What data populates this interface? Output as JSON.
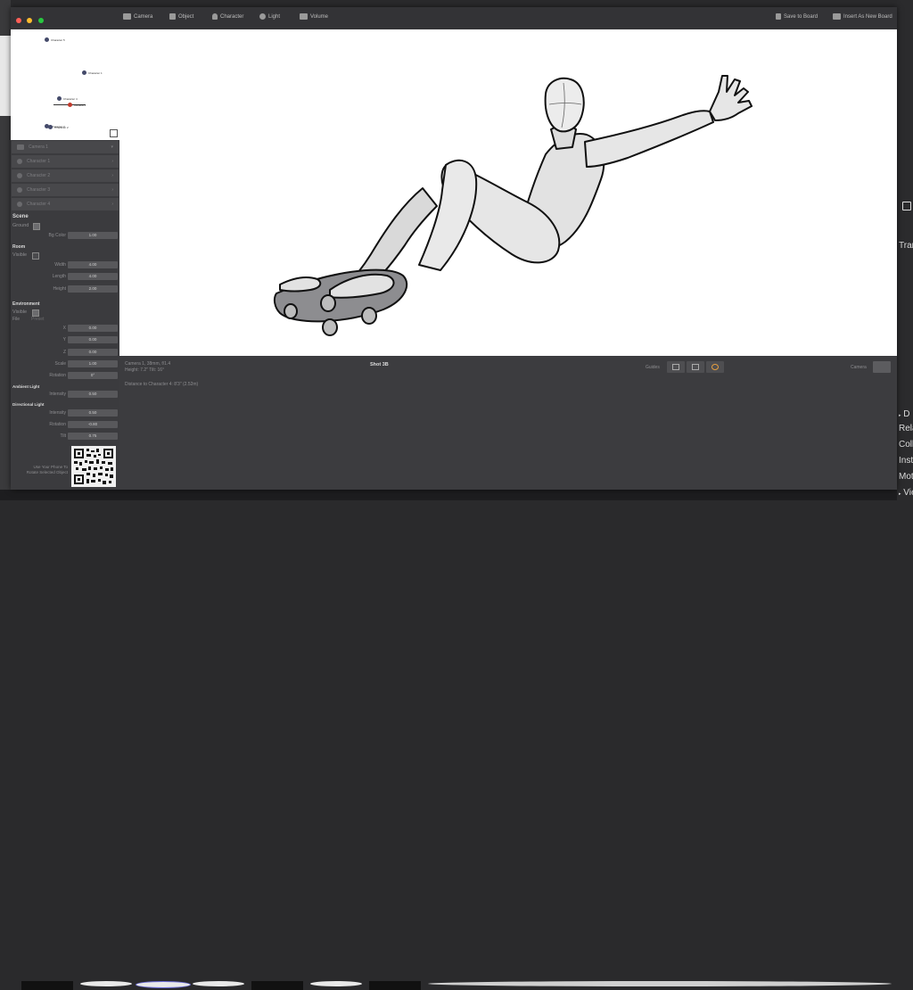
{
  "desktop": {
    "right_labels": [
      "Tran",
      "D",
      "Rela",
      "Coll",
      "Inst",
      "Mot",
      "View"
    ]
  },
  "toolbar": {
    "buttons": [
      {
        "label": "Camera",
        "icon": "camera-icon"
      },
      {
        "label": "Object",
        "icon": "cube-icon"
      },
      {
        "label": "Character",
        "icon": "person-icon"
      },
      {
        "label": "Light",
        "icon": "light-icon"
      },
      {
        "label": "Volume",
        "icon": "volume-icon"
      }
    ],
    "save_label": "Save to Board",
    "insert_label": "Insert As New Board"
  },
  "overhead": {
    "markers": [
      "Character 5",
      "Character 1",
      "Character 4",
      "Camera 1",
      "Character 3",
      "Character 2"
    ]
  },
  "objects": [
    {
      "label": "Camera 1"
    },
    {
      "label": "Character 1"
    },
    {
      "label": "Character 2"
    },
    {
      "label": "Character 3"
    },
    {
      "label": "Character 4"
    }
  ],
  "scene": {
    "title": "Scene",
    "ground_label": "Ground",
    "bg_color_label": "Bg Color",
    "bg_color_value": "1.00"
  },
  "room": {
    "title": "Room",
    "visible_label": "Visible",
    "width_label": "Width",
    "width_value": "4.00",
    "length_label": "Length",
    "length_value": "4.00",
    "height_label": "Height",
    "height_value": "2.00"
  },
  "environment": {
    "title": "Environment",
    "visible_label": "Visible",
    "file_label": "File",
    "preset_label": "Preset",
    "x_label": "X",
    "x_value": "0.00",
    "y_label": "Y",
    "y_value": "0.00",
    "z_label": "Z",
    "z_value": "0.00",
    "scale_label": "Scale",
    "scale_value": "1.00",
    "rotation_label": "Rotation",
    "rotation_value": "0°"
  },
  "ambient": {
    "title": "Ambient Light",
    "intensity_label": "Intensity",
    "intensity_value": "0.50"
  },
  "directional": {
    "title": "Directional Light",
    "intensity_label": "Intensity",
    "intensity_value": "0.50",
    "rotation_label": "Rotation",
    "rotation_value": "-0.80",
    "tilt_label": "Tilt",
    "tilt_value": "0.75"
  },
  "phone": {
    "line1": "Use Your Phone To",
    "line2": "Rotate Selected Object"
  },
  "bottom": {
    "camera_info": "Camera 1, 38mm, f/1.4",
    "height_info": "Height: 7.2\" Tilt: 16°",
    "distance_info": "Distance to Character 4: 8'3\" (2.52m)",
    "shot_label": "Shot 3B",
    "guides_label": "Guides",
    "camera_label": "Camera"
  },
  "colors": {
    "close": "#ff5f57",
    "minimize": "#febc2e",
    "zoom": "#28c840",
    "marker": "#444a6a",
    "camera_marker": "#c0392b"
  }
}
